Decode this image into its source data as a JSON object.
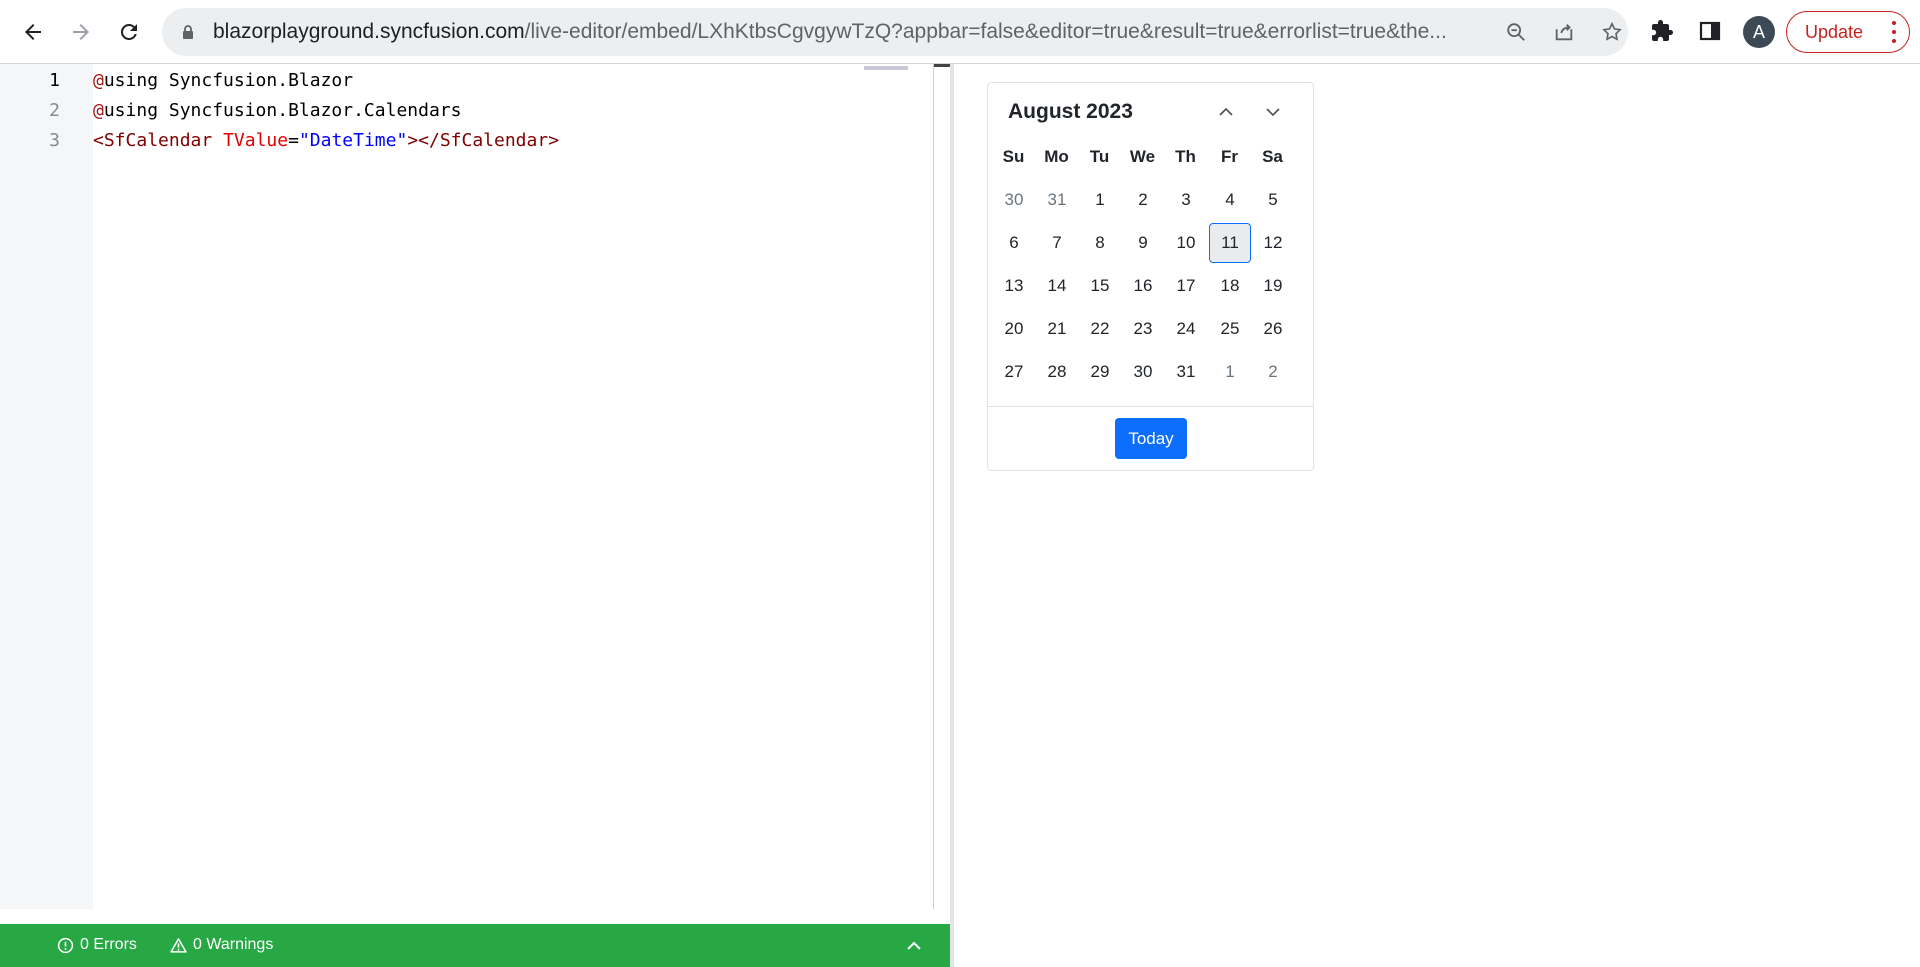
{
  "browser": {
    "url_host": "blazorplayground.syncfusion.com",
    "url_path": "/live-editor/embed/LXhKtbsCgvgywTzQ?appbar=false&editor=true&result=true&errorlist=true&the...",
    "avatar_letter": "A",
    "update_label": "Update"
  },
  "editor": {
    "line_numbers": [
      "1",
      "2",
      "3"
    ],
    "lines": [
      {
        "prefix": "@",
        "rest": "using Syncfusion.Blazor"
      },
      {
        "prefix": "@",
        "rest": "using Syncfusion.Blazor.Calendars"
      },
      {
        "open_lt": "<",
        "open_tag": "SfCalendar",
        "attr": "TValue",
        "eq": "=",
        "value": "\"DateTime\"",
        "mid": "></",
        "close_tag": "SfCalendar",
        "close_gt": ">"
      }
    ]
  },
  "status": {
    "errors": "0 Errors",
    "warnings": "0 Warnings"
  },
  "calendar": {
    "title": "August 2023",
    "weekdays": [
      "Su",
      "Mo",
      "Tu",
      "We",
      "Th",
      "Fr",
      "Sa"
    ],
    "weeks": [
      [
        "30",
        "31",
        "1",
        "2",
        "3",
        "4",
        "5"
      ],
      [
        "6",
        "7",
        "8",
        "9",
        "10",
        "11",
        "12"
      ],
      [
        "13",
        "14",
        "15",
        "16",
        "17",
        "18",
        "19"
      ],
      [
        "20",
        "21",
        "22",
        "23",
        "24",
        "25",
        "26"
      ],
      [
        "27",
        "28",
        "29",
        "30",
        "31",
        "1",
        "2"
      ]
    ],
    "selected_day": "11",
    "today_label": "Today",
    "accent_color": "#0d6efd"
  },
  "colors": {
    "status_bar": "#28a745",
    "update_red": "#c5221f"
  }
}
